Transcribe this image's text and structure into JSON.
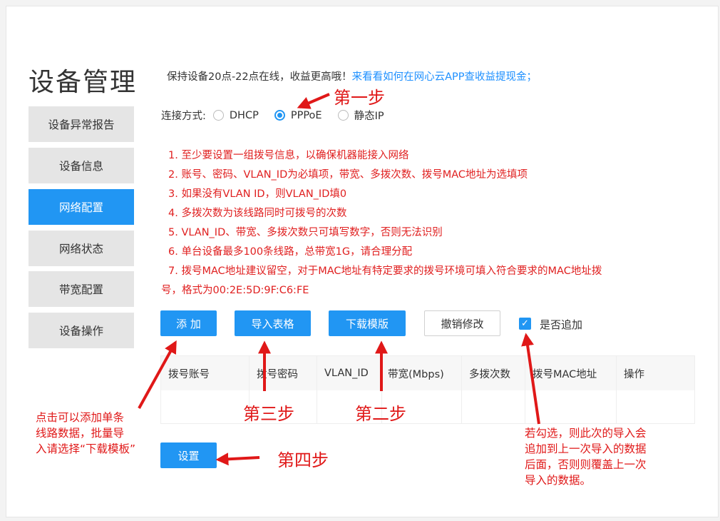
{
  "page_title": "设备管理",
  "notice": {
    "text": "保持设备20点-22点在线，收益更高哦！",
    "link": "来看看如何在网心云APP查收益提现金；"
  },
  "sidebar": {
    "items": [
      {
        "label": "设备异常报告",
        "active": false
      },
      {
        "label": "设备信息",
        "active": false
      },
      {
        "label": "网络配置",
        "active": true
      },
      {
        "label": "网络状态",
        "active": false
      },
      {
        "label": "带宽配置",
        "active": false
      },
      {
        "label": "设备操作",
        "active": false
      }
    ]
  },
  "connection": {
    "label": "连接方式:",
    "options": [
      "DHCP",
      "PPPoE",
      "静态IP"
    ],
    "selected": "PPPoE"
  },
  "tips": [
    "1. 至少要设置一组拨号信息，以确保机器能接入网络",
    "2. 账号、密码、VLAN_ID为必填项，带宽、多拨次数、拨号MAC地址为选填项",
    "3. 如果没有VLAN ID，则VLAN_ID填0",
    "4. 多拨次数为该线路同时可拨号的次数",
    "5. VLAN_ID、带宽、多拨次数只可填写数字，否则无法识别",
    "6. 单台设备最多100条线路，总带宽1G，请合理分配",
    "7. 拨号MAC地址建议留空，对于MAC地址有特定要求的拨号环境可填入符合要求的MAC地址拨",
    "号，格式为00:2E:5D:9F:C6:FE"
  ],
  "buttons": {
    "add": "添 加",
    "import": "导入表格",
    "download": "下载模版",
    "revert": "撤销修改",
    "append_label": "是否追加",
    "append_checked": true,
    "submit": "设置"
  },
  "table": {
    "columns": [
      "拨号账号",
      "拨号密码",
      "VLAN_ID",
      "带宽(Mbps)",
      "多拨次数",
      "拨号MAC地址",
      "操作"
    ]
  },
  "annotations": {
    "step1": "第一步",
    "step2": "第二步",
    "step3": "第三步",
    "step4": "第四步",
    "left_note": [
      "点击可以添加单条",
      "线路数据，批量导",
      "入请选择“下载模板”"
    ],
    "right_note": [
      "若勾选，则此次的导入会",
      "追加到上一次导入的数据",
      "后面，否则则覆盖上一次",
      "导入的数据。"
    ]
  },
  "colors": {
    "accent": "#2196f3",
    "annotation": "#e01818",
    "tip_text": "#e02020"
  }
}
